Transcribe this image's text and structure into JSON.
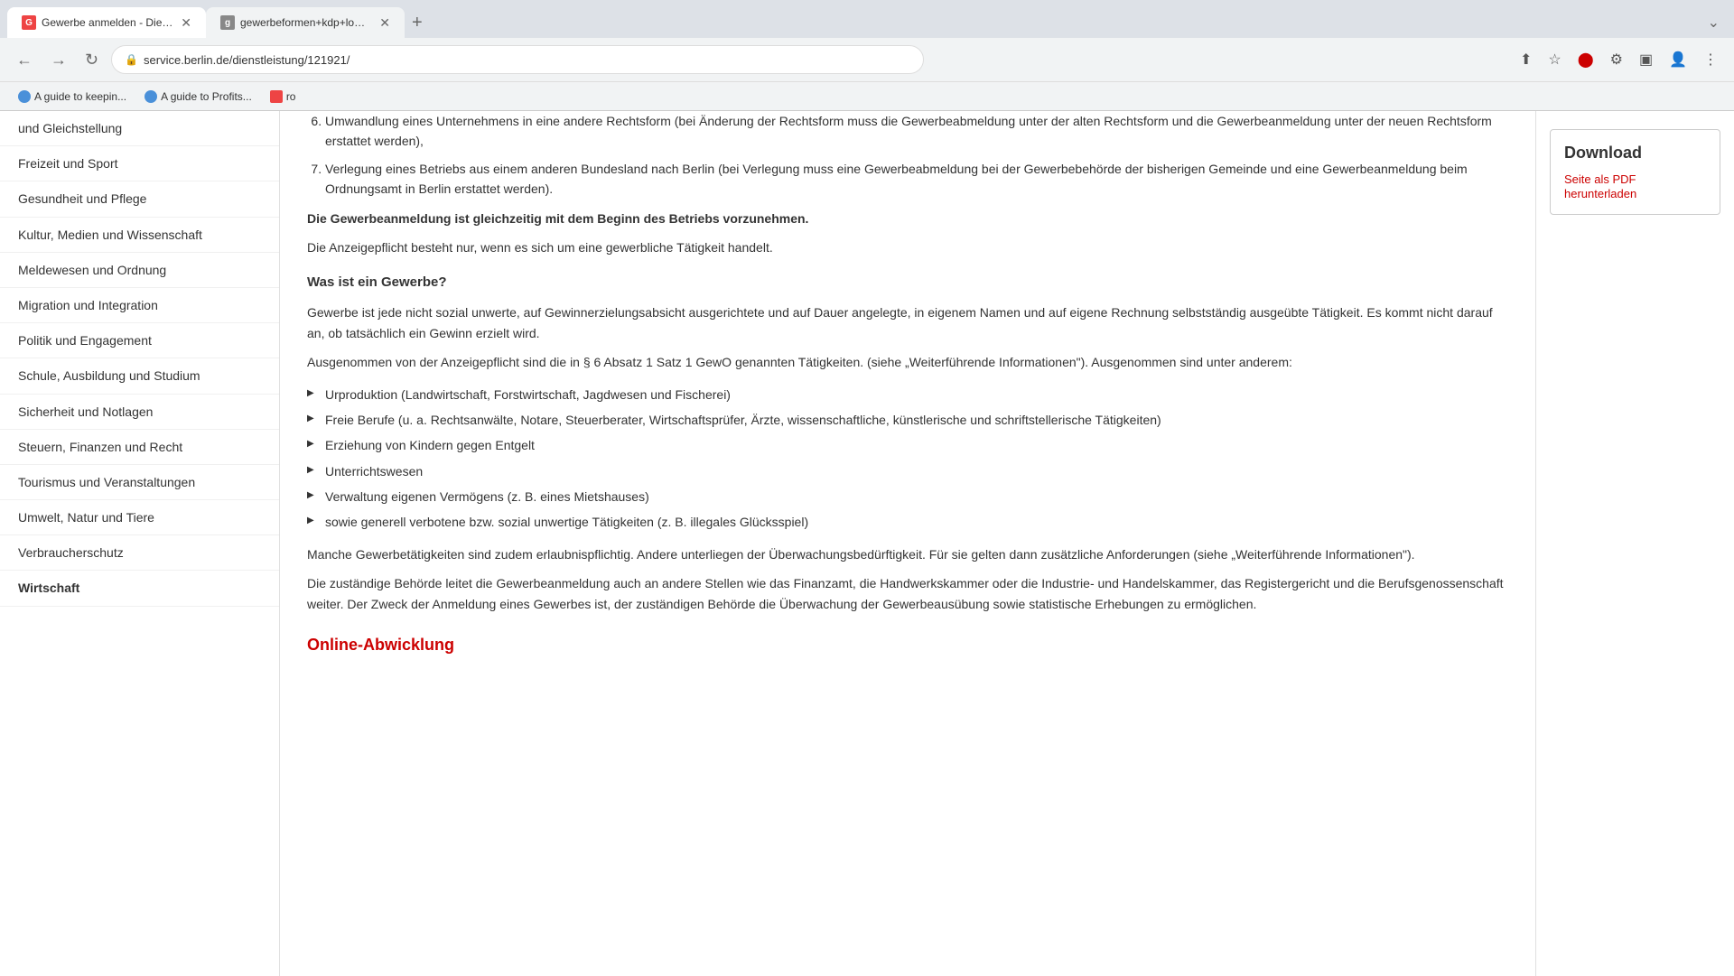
{
  "browser": {
    "tabs": [
      {
        "id": "tab1",
        "label": "Gewerbe anmelden - Dienstlei...",
        "url": "service.berlin.de/dienstleistung/121921/",
        "active": true,
        "favicon": "G"
      },
      {
        "id": "tab2",
        "label": "gewerbeformen+kdp+low+con...",
        "url": "gewerbeformen+kdp+low+con...",
        "active": false,
        "favicon": "g"
      }
    ],
    "address": "service.berlin.de/dienstleistung/121921/",
    "bookmarks": [
      {
        "label": "A guide to keepin...",
        "icon_color": "#4a90d9"
      },
      {
        "label": "A guide to Profits...",
        "icon_color": "#4a90d9"
      },
      {
        "label": "ro",
        "icon_color": "#e44"
      }
    ]
  },
  "sidebar": {
    "items": [
      {
        "label": "und Gleichstellung",
        "active": false
      },
      {
        "label": "Freizeit und Sport",
        "active": false
      },
      {
        "label": "Gesundheit und Pflege",
        "active": false
      },
      {
        "label": "Kultur, Medien und Wissenschaft",
        "active": false
      },
      {
        "label": "Meldewesen und Ordnung",
        "active": false
      },
      {
        "label": "Migration und Integration",
        "active": false
      },
      {
        "label": "Politik und Engagement",
        "active": false
      },
      {
        "label": "Schule, Ausbildung und Studium",
        "active": false
      },
      {
        "label": "Sicherheit und Notlagen",
        "active": false
      },
      {
        "label": "Steuern, Finanzen und Recht",
        "active": false
      },
      {
        "label": "Tourismus und Veranstaltungen",
        "active": false
      },
      {
        "label": "Umwelt, Natur und Tiere",
        "active": false
      },
      {
        "label": "Verbraucherschutz",
        "active": false
      },
      {
        "label": "Wirtschaft",
        "active": true,
        "bold": true
      }
    ]
  },
  "main": {
    "numbered_items": [
      {
        "number": 6,
        "text": "Umwandlung eines Unternehmens in eine andere Rechtsform (bei Änderung der Rechtsform muss die Gewerbeabmeldung unter der alten Rechtsform und die Gewerbeanmeldung unter der neuen Rechtsform erstattet werden),"
      },
      {
        "number": 7,
        "text": "Verlegung eines Betriebs aus einem anderen Bundesland nach Berlin (bei Verlegung muss eine Gewerbeabmeldung bei der Gewerbebehörde der bisherigen Gemeinde und eine Gewerbeanmeldung beim Ordnungsamt in Berlin erstattet werden)."
      }
    ],
    "bold_paragraph": "Die Gewerbeanmeldung ist gleichzeitig mit dem Beginn des Betriebs vorzunehmen.",
    "sub_paragraph": "Die Anzeigepflicht besteht nur, wenn es sich um eine gewerbliche Tätigkeit handelt.",
    "what_is_heading": "Was ist ein Gewerbe?",
    "what_is_paragraph": "Gewerbe ist jede nicht sozial unwerte, auf Gewinnerzielungsabsicht ausgerichtete und auf Dauer angelegte, in eigenem Namen und auf eigene Rechnung selbstständig ausgeübte Tätigkeit. Es kommt nicht darauf an, ob tatsächlich ein Gewinn erzielt wird.",
    "exempt_intro": "Ausgenommen von der Anzeigepflicht sind die in § 6 Absatz 1 Satz 1 GewO genannten Tätigkeiten. (siehe „Weiterführende Informationen\"). Ausgenommen sind unter anderem:",
    "bullet_items": [
      "Urproduktion (Landwirtschaft, Forstwirtschaft, Jagdwesen und Fischerei)",
      "Freie Berufe (u. a. Rechtsanwälte, Notare, Steuerberater, Wirtschaftsprüfer, Ärzte, wissenschaftliche, künstlerische und schriftstellerische Tätigkeiten)",
      "Erziehung von Kindern gegen Entgelt",
      "Unterrichtswesen",
      "Verwaltung eigenen Vermögens (z. B. eines Mietshauses)",
      "sowie generell verbotene bzw. sozial unwertige Tätigkeiten (z. B. illegales Glücksspiel)"
    ],
    "erlaubnis_paragraph": "Manche Gewerbetätigkeiten sind zudem erlaubnispflichtig. Andere unterliegen der Überwachungsbedürftigkeit. Für sie gelten dann zusätzliche Anforderungen (siehe „Weiterführende Informationen\").",
    "behoerde_paragraph": "Die zuständige Behörde leitet die Gewerbeanmeldung auch an andere Stellen wie das Finanzamt, die Handwerkskammer oder die Industrie- und Handelskammer, das Registergericht und die Berufsgenossenschaft weiter. Der Zweck der Anmeldung eines Gewerbes ist, der zuständigen Behörde die Überwachung der Gewerbeausübung sowie statistische Erhebungen zu ermöglichen.",
    "online_heading": "Online-Abwicklung"
  },
  "right_sidebar": {
    "download_title": "Download",
    "download_link_label": "Seite als PDF herunterladen"
  }
}
